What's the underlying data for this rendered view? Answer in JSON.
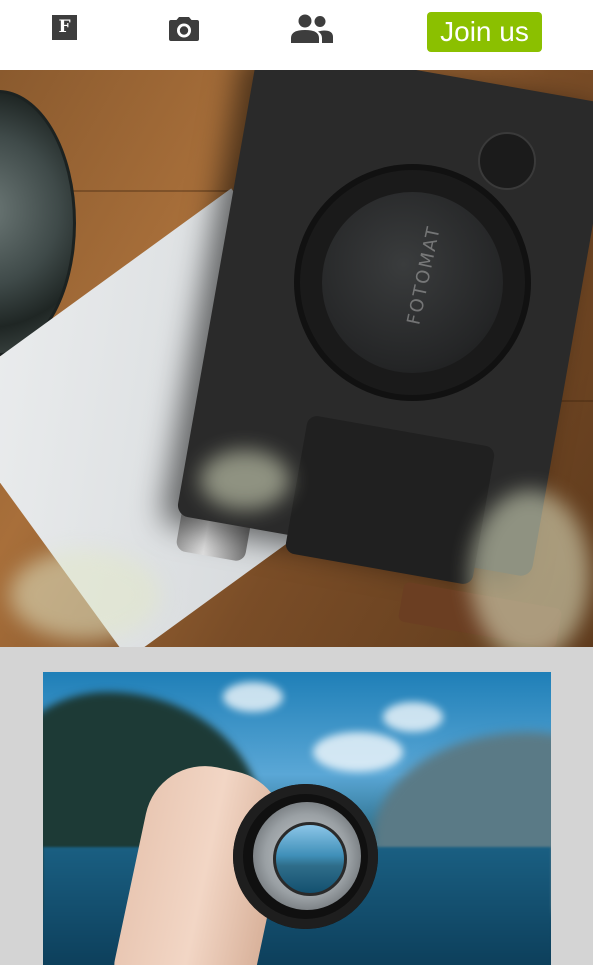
{
  "nav": {
    "logo_letter": "F",
    "logo_icon": "logo-f-icon",
    "camera_icon": "camera-icon",
    "community_icon": "people-icon",
    "join_label": "Join us",
    "accent_color": "#8bc000"
  },
  "hero_image": {
    "cap_text": "FOTOMAT"
  }
}
